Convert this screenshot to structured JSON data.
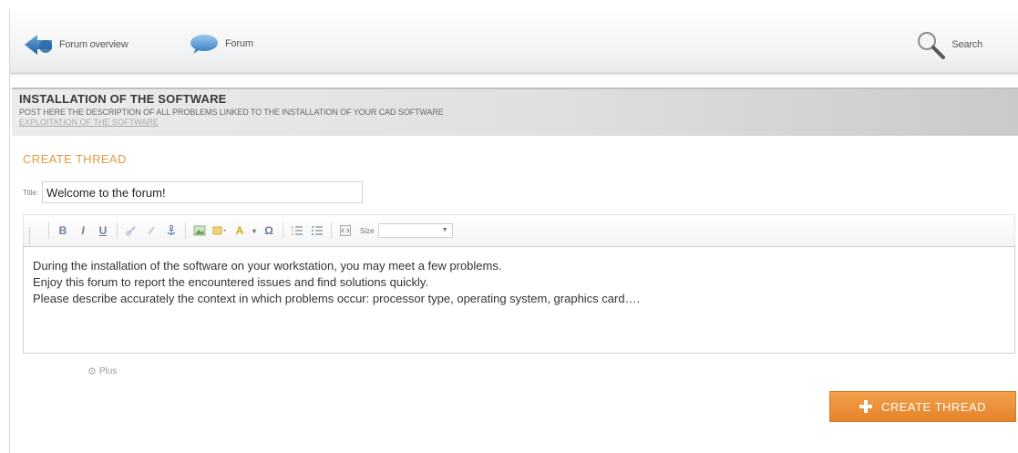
{
  "nav": {
    "overview_label": "Forum overview",
    "forum_label": "Forum",
    "search_label": "Search"
  },
  "section": {
    "title": "INSTALLATION OF THE SOFTWARE",
    "description": "POST HERE THE DESCRIPTION OF ALL PROBLEMS LINKED TO THE INSTALLATION OF YOUR CAD SOFTWARE",
    "subtitle": "EXPLOITATION OF THE SOFTWARE"
  },
  "form": {
    "heading": "CREATE THREAD",
    "title_label": "Title:",
    "title_value": "Welcome to the forum!"
  },
  "toolbar": {
    "bold": "B",
    "italic": "I",
    "underline": "U",
    "text_color": "A",
    "special_char": "Ω",
    "size_label": "Size",
    "size_value": ""
  },
  "editor": {
    "lines": [
      "During the installation of the software on your workstation, you may meet a few problems.",
      "Enjoy this forum to report the encountered issues and find solutions quickly.",
      "Please describe accurately the context in which problems occur: processor type, operating system, graphics card…."
    ]
  },
  "more_label": "Plus",
  "submit_label": "CREATE THREAD",
  "colors": {
    "accent": "#e5832b",
    "heading": "#e59b3c",
    "icon_blue": "#2e6da4"
  }
}
